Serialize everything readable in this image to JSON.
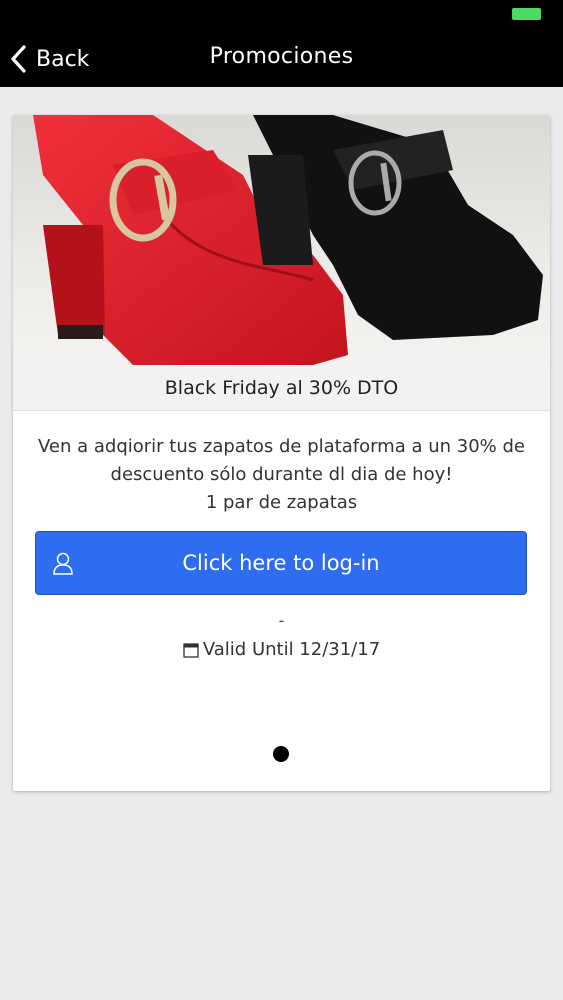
{
  "header": {
    "back_label": "Back",
    "title": "Promociones",
    "back_icon": "chevron-left-icon",
    "battery_color": "#4cd964"
  },
  "promo": {
    "image_caption": "Black Friday al 30% DTO",
    "description": "Ven a adqiorir tus zapatos de plataforma a un 30% de descuento sólo durante dl dia de hoy!",
    "quantity": "1 par de zapatas",
    "login_button_label": "Click here to log-in",
    "login_icon": "user-icon",
    "separator": "-",
    "valid_until": "Valid Until 12/31/17",
    "valid_icon": "calendar-icon"
  },
  "pagination": {
    "current_page": 1,
    "total_pages": 1
  },
  "colors": {
    "accent": "#2f6df0",
    "topbar": "#000000",
    "background": "#ebeaec"
  }
}
